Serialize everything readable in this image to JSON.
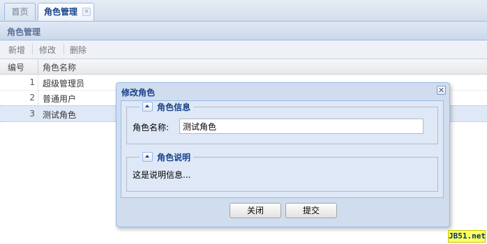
{
  "tabs": [
    {
      "label": "首页",
      "active": false
    },
    {
      "label": "角色管理",
      "active": true,
      "closable": true
    }
  ],
  "panel": {
    "title": "角色管理"
  },
  "toolbar": {
    "add": "新增",
    "edit": "修改",
    "delete": "删除"
  },
  "grid": {
    "columns": [
      "编号",
      "角色名称"
    ],
    "rows": [
      {
        "num": "1",
        "name": "超级管理员"
      },
      {
        "num": "2",
        "name": "普通用户"
      },
      {
        "num": "3",
        "name": "测试角色",
        "selected": true
      }
    ]
  },
  "dialog": {
    "title": "修改角色",
    "section_info": "角色信息",
    "name_label": "角色名称:",
    "name_value": "测试角色",
    "section_desc": "角色说明",
    "desc_text": "这是说明信息...",
    "close_button": "关闭",
    "submit_button": "提交"
  },
  "watermark": "JB51.net",
  "icons": {
    "tab_close": "close-icon",
    "window_close": "close-icon",
    "section_toggle": "collapse-up-icon"
  },
  "colors": {
    "accent": "#15428b",
    "border": "#99bbe8",
    "selected_row": "#dfe8f6"
  }
}
